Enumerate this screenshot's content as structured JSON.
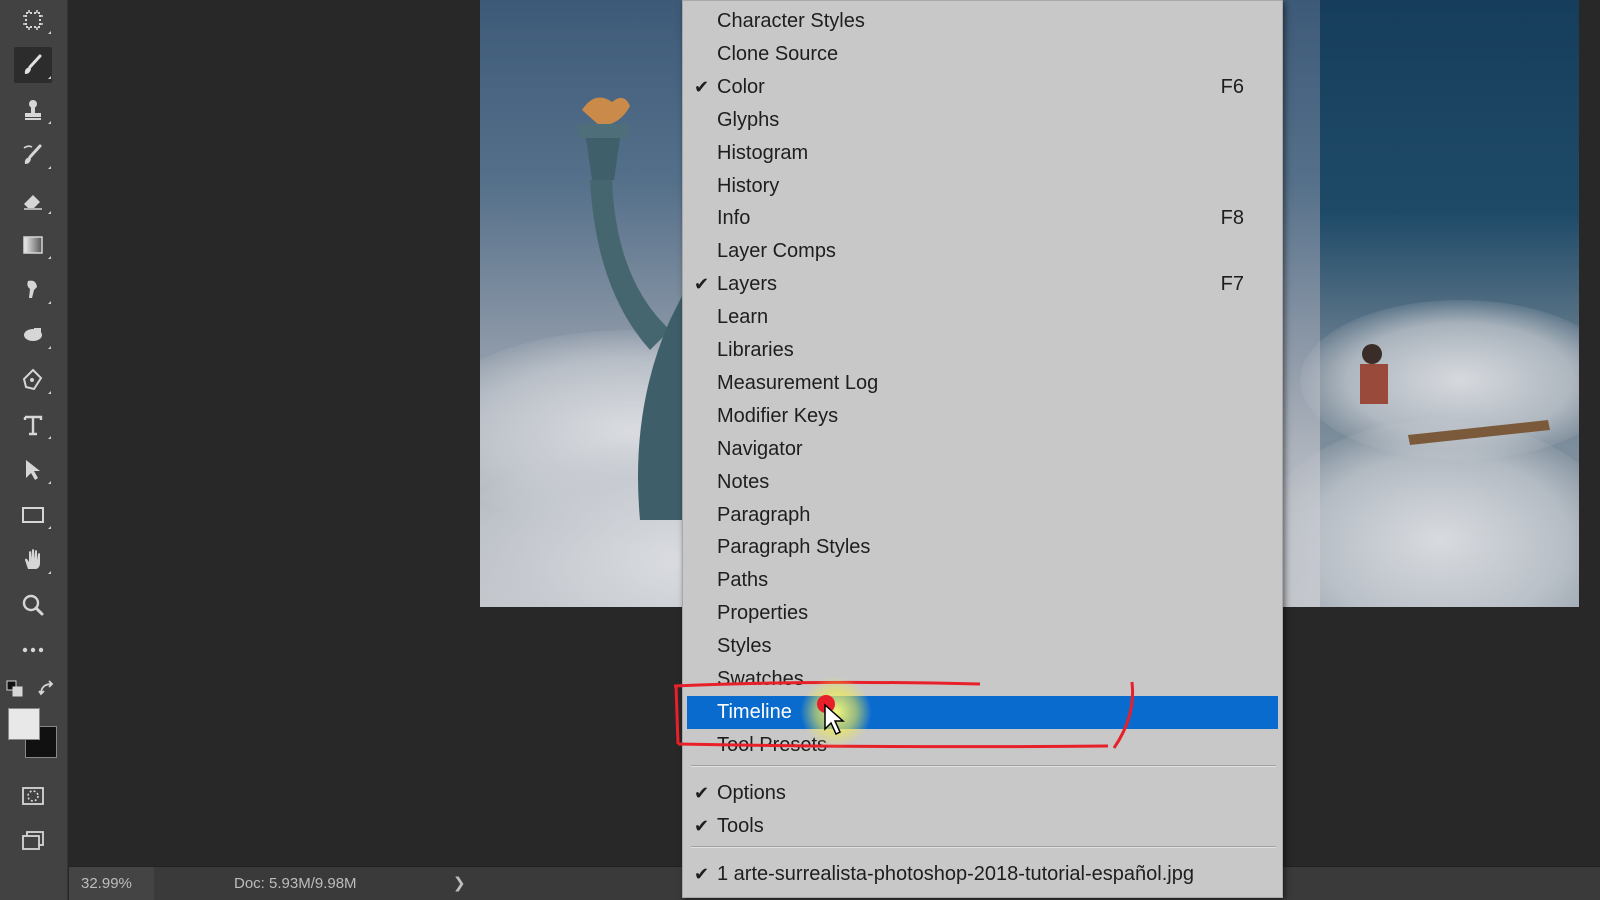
{
  "toolbar": {
    "tools": [
      {
        "name": "artboard-tool-icon"
      },
      {
        "name": "brush-tool-icon",
        "active": true
      },
      {
        "name": "clone-stamp-tool-icon"
      },
      {
        "name": "history-brush-tool-icon"
      },
      {
        "name": "eraser-tool-icon"
      },
      {
        "name": "gradient-tool-icon"
      },
      {
        "name": "smudge-tool-icon"
      },
      {
        "name": "dodge-tool-icon"
      },
      {
        "name": "pen-tool-icon"
      },
      {
        "name": "type-tool-icon"
      },
      {
        "name": "path-selection-tool-icon"
      },
      {
        "name": "rectangle-tool-icon"
      },
      {
        "name": "hand-tool-icon"
      },
      {
        "name": "zoom-tool-icon"
      },
      {
        "name": "more-tools-icon"
      }
    ],
    "foreground_color": "#e8e8e8",
    "background_color": "#111111"
  },
  "status_bar": {
    "zoom": "32.99%",
    "doc_info": "Doc: 5.93M/9.98M",
    "arrow": "❯"
  },
  "menu": {
    "items": [
      {
        "label": "Character Styles",
        "checked": false,
        "shortcut": ""
      },
      {
        "label": "Clone Source",
        "checked": false,
        "shortcut": ""
      },
      {
        "label": "Color",
        "checked": true,
        "shortcut": "F6"
      },
      {
        "label": "Glyphs",
        "checked": false,
        "shortcut": ""
      },
      {
        "label": "Histogram",
        "checked": false,
        "shortcut": ""
      },
      {
        "label": "History",
        "checked": false,
        "shortcut": ""
      },
      {
        "label": "Info",
        "checked": false,
        "shortcut": "F8"
      },
      {
        "label": "Layer Comps",
        "checked": false,
        "shortcut": ""
      },
      {
        "label": "Layers",
        "checked": true,
        "shortcut": "F7"
      },
      {
        "label": "Learn",
        "checked": false,
        "shortcut": ""
      },
      {
        "label": "Libraries",
        "checked": false,
        "shortcut": ""
      },
      {
        "label": "Measurement Log",
        "checked": false,
        "shortcut": ""
      },
      {
        "label": "Modifier Keys",
        "checked": false,
        "shortcut": ""
      },
      {
        "label": "Navigator",
        "checked": false,
        "shortcut": ""
      },
      {
        "label": "Notes",
        "checked": false,
        "shortcut": ""
      },
      {
        "label": "Paragraph",
        "checked": false,
        "shortcut": ""
      },
      {
        "label": "Paragraph Styles",
        "checked": false,
        "shortcut": ""
      },
      {
        "label": "Paths",
        "checked": false,
        "shortcut": ""
      },
      {
        "label": "Properties",
        "checked": false,
        "shortcut": ""
      },
      {
        "label": "Styles",
        "checked": false,
        "shortcut": ""
      },
      {
        "label": "Swatches",
        "checked": false,
        "shortcut": ""
      },
      {
        "label": "Timeline",
        "checked": false,
        "shortcut": "",
        "highlighted": true
      },
      {
        "label": "Tool Presets",
        "checked": false,
        "shortcut": ""
      }
    ],
    "workspace_items": [
      {
        "label": "Options",
        "checked": true
      },
      {
        "label": "Tools",
        "checked": true
      }
    ],
    "document_items": [
      {
        "label": "1 arte-surrealista-photoshop-2018-tutorial-español.jpg",
        "checked": true
      }
    ],
    "check_glyph": "✔"
  },
  "colors": {
    "menu_highlight": "#0a6bce",
    "annotation": "#e8202a"
  }
}
